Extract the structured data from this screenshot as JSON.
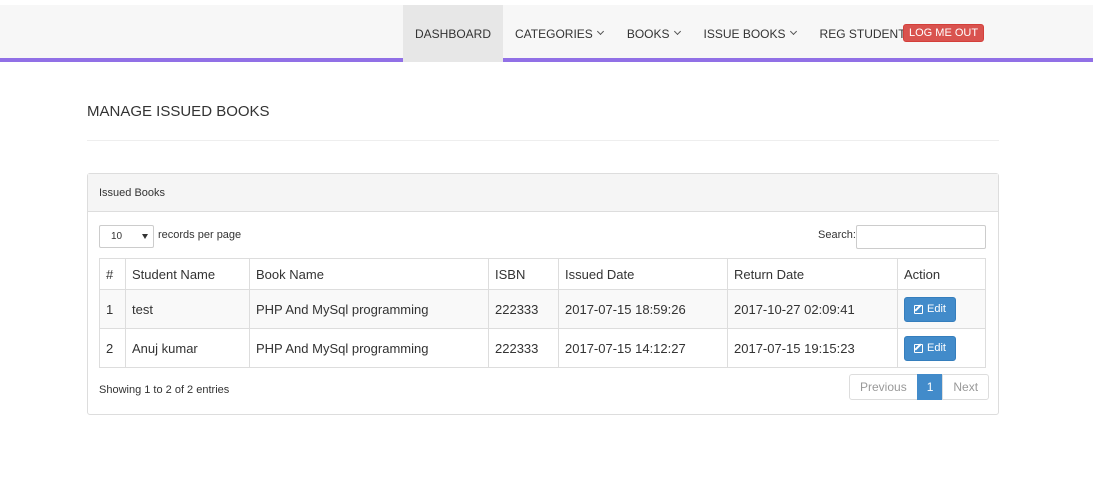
{
  "nav": {
    "items": [
      {
        "label": "DASHBOARD",
        "dropdown": false,
        "active": true
      },
      {
        "label": "CATEGORIES",
        "dropdown": true
      },
      {
        "label": "BOOKS",
        "dropdown": true
      },
      {
        "label": "ISSUE BOOKS",
        "dropdown": true
      },
      {
        "label": "REG STUDENTS",
        "dropdown": false
      }
    ],
    "logout_label": "LOG ME OUT"
  },
  "page": {
    "title": "MANAGE ISSUED BOOKS"
  },
  "panel": {
    "heading": "Issued Books",
    "length": {
      "selected": "10",
      "label": "records per page"
    },
    "search": {
      "label": "Search:",
      "value": ""
    },
    "table": {
      "columns": [
        "#",
        "Student Name",
        "Book Name",
        "ISBN",
        "Issued Date",
        "Return Date",
        "Action"
      ],
      "rows": [
        {
          "num": "1",
          "student": "test",
          "book": "PHP And MySql programming",
          "isbn": "222333",
          "issued": "2017-07-15 18:59:26",
          "returned": "2017-10-27 02:09:41",
          "action": "Edit"
        },
        {
          "num": "2",
          "student": "Anuj kumar",
          "book": "PHP And MySql programming",
          "isbn": "222333",
          "issued": "2017-07-15 14:12:27",
          "returned": "2017-07-15 19:15:23",
          "action": "Edit"
        }
      ]
    },
    "info": "Showing 1 to 2 of 2 entries",
    "pagination": {
      "previous": "Previous",
      "current": "1",
      "next": "Next"
    }
  },
  "colors": {
    "accent_bar": "#9170e6",
    "primary": "#428bca",
    "danger": "#d9534f"
  }
}
